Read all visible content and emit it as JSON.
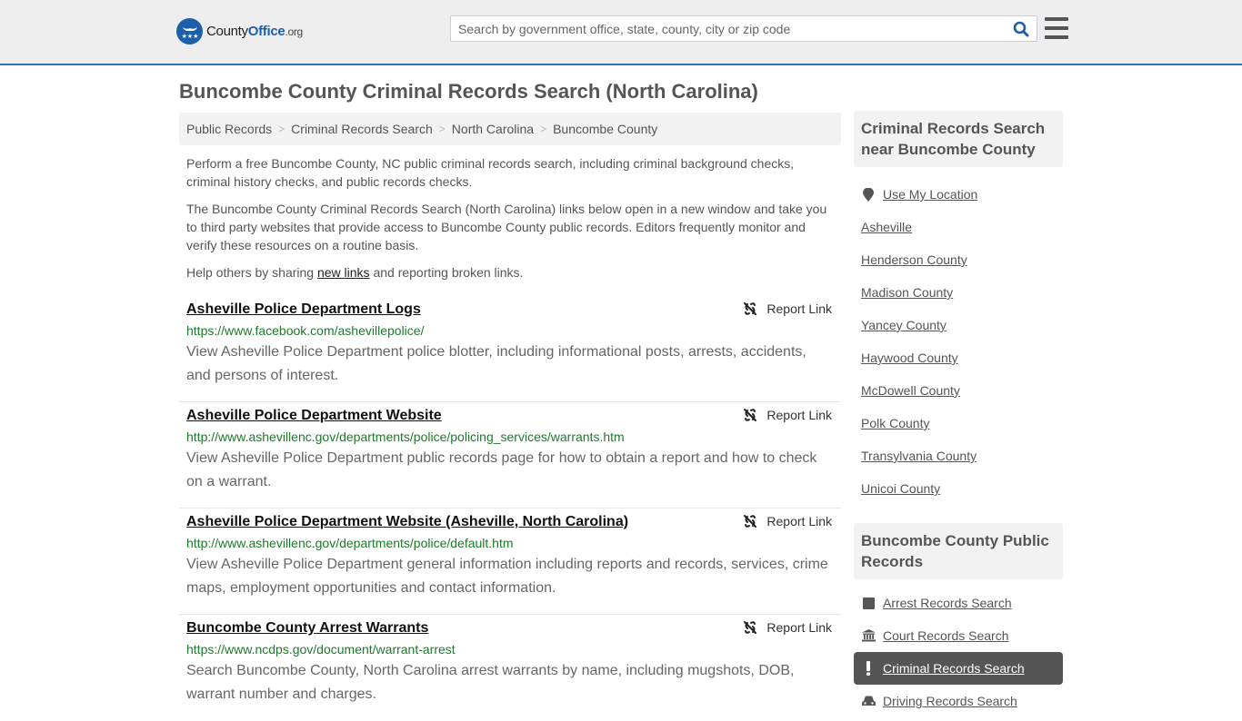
{
  "header": {
    "logo": {
      "county": "County",
      "office": "Office",
      "tld": ".org",
      "icon": "eagle-stars-icon"
    },
    "search": {
      "placeholder": "Search by government office, state, county, city or zip code",
      "value": "",
      "icon": "search-icon"
    },
    "menu_icon": "hamburger-menu-icon"
  },
  "page": {
    "title": "Buncombe County Criminal Records Search (North Carolina)"
  },
  "breadcrumb": [
    {
      "label": "Public Records"
    },
    {
      "label": "Criminal Records Search"
    },
    {
      "label": "North Carolina"
    },
    {
      "label": "Buncombe County"
    }
  ],
  "breadcrumb_separator": ">",
  "intro": {
    "p1": "Perform a free Buncombe County, NC public criminal records search, including criminal background checks, criminal history checks, and public records checks.",
    "p2": "The Buncombe County Criminal Records Search (North Carolina) links below open in a new window and take you to third party websites that provide access to Buncombe County public records. Editors frequently monitor and verify these resources on a routine basis.",
    "p3_before": "Help others by sharing ",
    "p3_link": "new links",
    "p3_after": " and reporting broken links."
  },
  "results": [
    {
      "title": "Asheville Police Department Logs",
      "url": "https://www.facebook.com/ashevillepolice/",
      "description": "View Asheville Police Department police blotter, including informational posts, arrests, accidents, and persons of interest.",
      "report_label": "Report Link"
    },
    {
      "title": "Asheville Police Department Website",
      "url": "http://www.ashevillenc.gov/departments/police/policing_services/warrants.htm",
      "description": "View Asheville Police Department public records page for how to obtain a report and how to check on a warrant.",
      "report_label": "Report Link"
    },
    {
      "title": "Asheville Police Department Website (Asheville, North Carolina)",
      "url": "http://www.ashevillenc.gov/departments/police/default.htm",
      "description": "View Asheville Police Department general information including reports and records, services, crime maps, employment opportunities and contact information.",
      "report_label": "Report Link"
    },
    {
      "title": "Buncombe County Arrest Warrants",
      "url": "https://www.ncdps.gov/document/warrant-arrest",
      "description": "Search Buncombe County, North Carolina arrest warrants by name, including mugshots, DOB, warrant number and charges.",
      "report_label": "Report Link"
    }
  ],
  "sidebar": {
    "nearby": {
      "heading": "Criminal Records Search near Buncombe County",
      "use_location": "Use My Location",
      "items": [
        "Asheville",
        "Henderson County",
        "Madison County",
        "Yancey County",
        "Haywood County",
        "McDowell County",
        "Polk County",
        "Transylvania County",
        "Unicoi County"
      ]
    },
    "records": {
      "heading": "Buncombe County Public Records",
      "items": [
        {
          "label": "Arrest Records Search",
          "icon": "square-icon",
          "active": false
        },
        {
          "label": "Court Records Search",
          "icon": "courthouse-icon",
          "active": false
        },
        {
          "label": "Criminal Records Search",
          "icon": "exclamation-icon",
          "active": true
        },
        {
          "label": "Driving Records Search",
          "icon": "car-icon",
          "active": false
        }
      ]
    }
  },
  "colors": {
    "brand_blue": "#1d5fa8",
    "header_border": "#2f72b0",
    "url_green": "#1e7a2b",
    "active_bg": "#555555"
  }
}
